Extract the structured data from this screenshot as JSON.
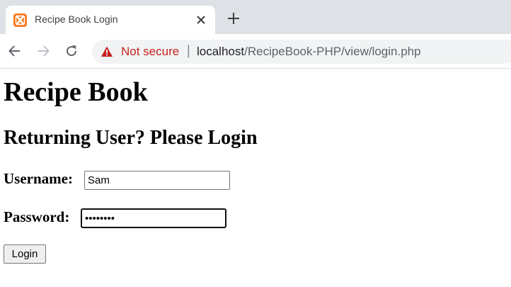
{
  "browser": {
    "tab_title": "Recipe Book Login",
    "security_label": "Not secure",
    "url_host": "localhost",
    "url_path": "/RecipeBook-PHP/view/login.php",
    "warning_color": "#c5221f",
    "favicon_color": "#f47a20",
    "icons": {
      "favicon": "xampp-favicon-icon",
      "close": "close-icon",
      "new_tab": "plus-icon",
      "back": "arrow-left-icon",
      "forward": "arrow-right-icon",
      "reload": "reload-icon",
      "warning": "warning-triangle-icon"
    }
  },
  "page": {
    "title": "Recipe Book",
    "subtitle": "Returning User? Please Login",
    "form": {
      "username_label": "Username:",
      "username_value": "Sam",
      "password_label": "Password:",
      "password_value": "abcdefgh",
      "submit_label": "Login"
    }
  }
}
